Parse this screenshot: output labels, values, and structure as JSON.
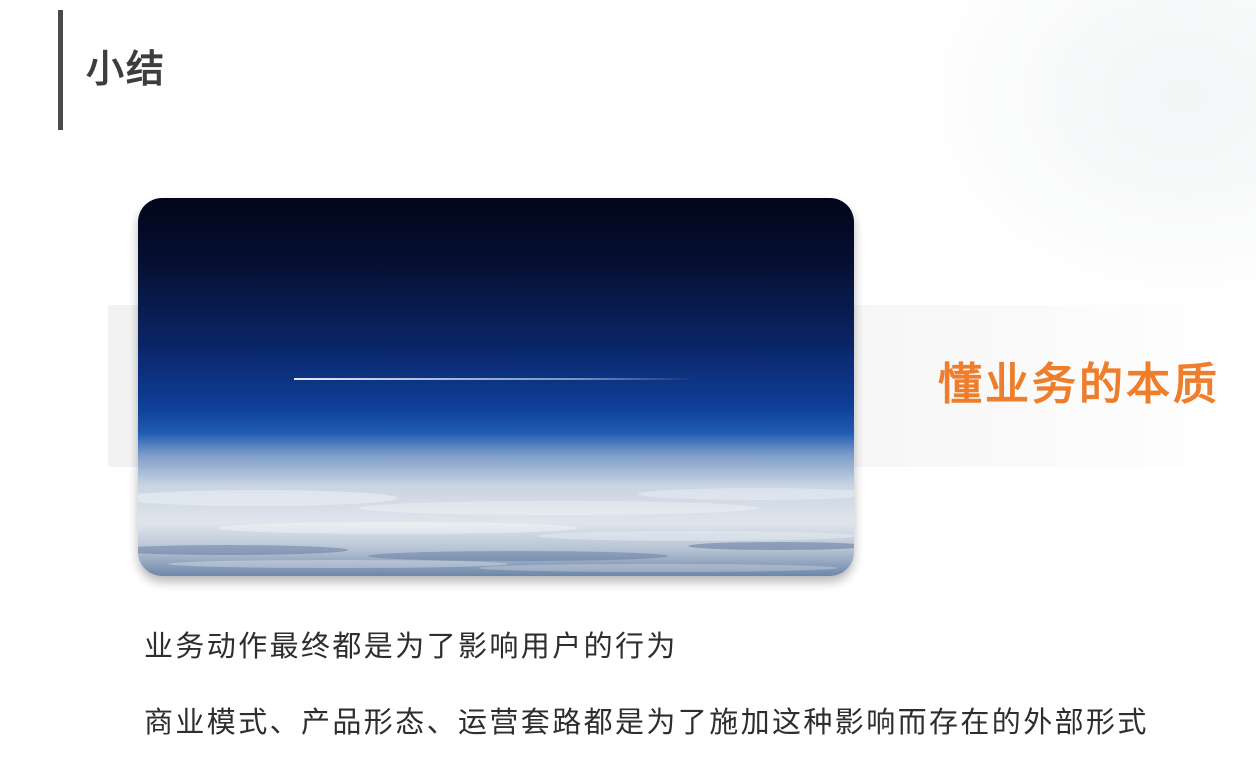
{
  "slide": {
    "title": "小结",
    "highlight": "懂业务的本质",
    "lines": [
      "业务动作最终都是为了影响用户的行为",
      "商业模式、产品形态、运营套路都是为了施加这种影响而存在的外部形式"
    ]
  },
  "colors": {
    "accent": "#ee7d2c",
    "title_text": "#3d3d3d",
    "body_text": "#2e2e2e",
    "title_bar": "#4a4a4a"
  },
  "photo": {
    "subject": "earth-horizon-from-stratosphere-with-contrail"
  }
}
